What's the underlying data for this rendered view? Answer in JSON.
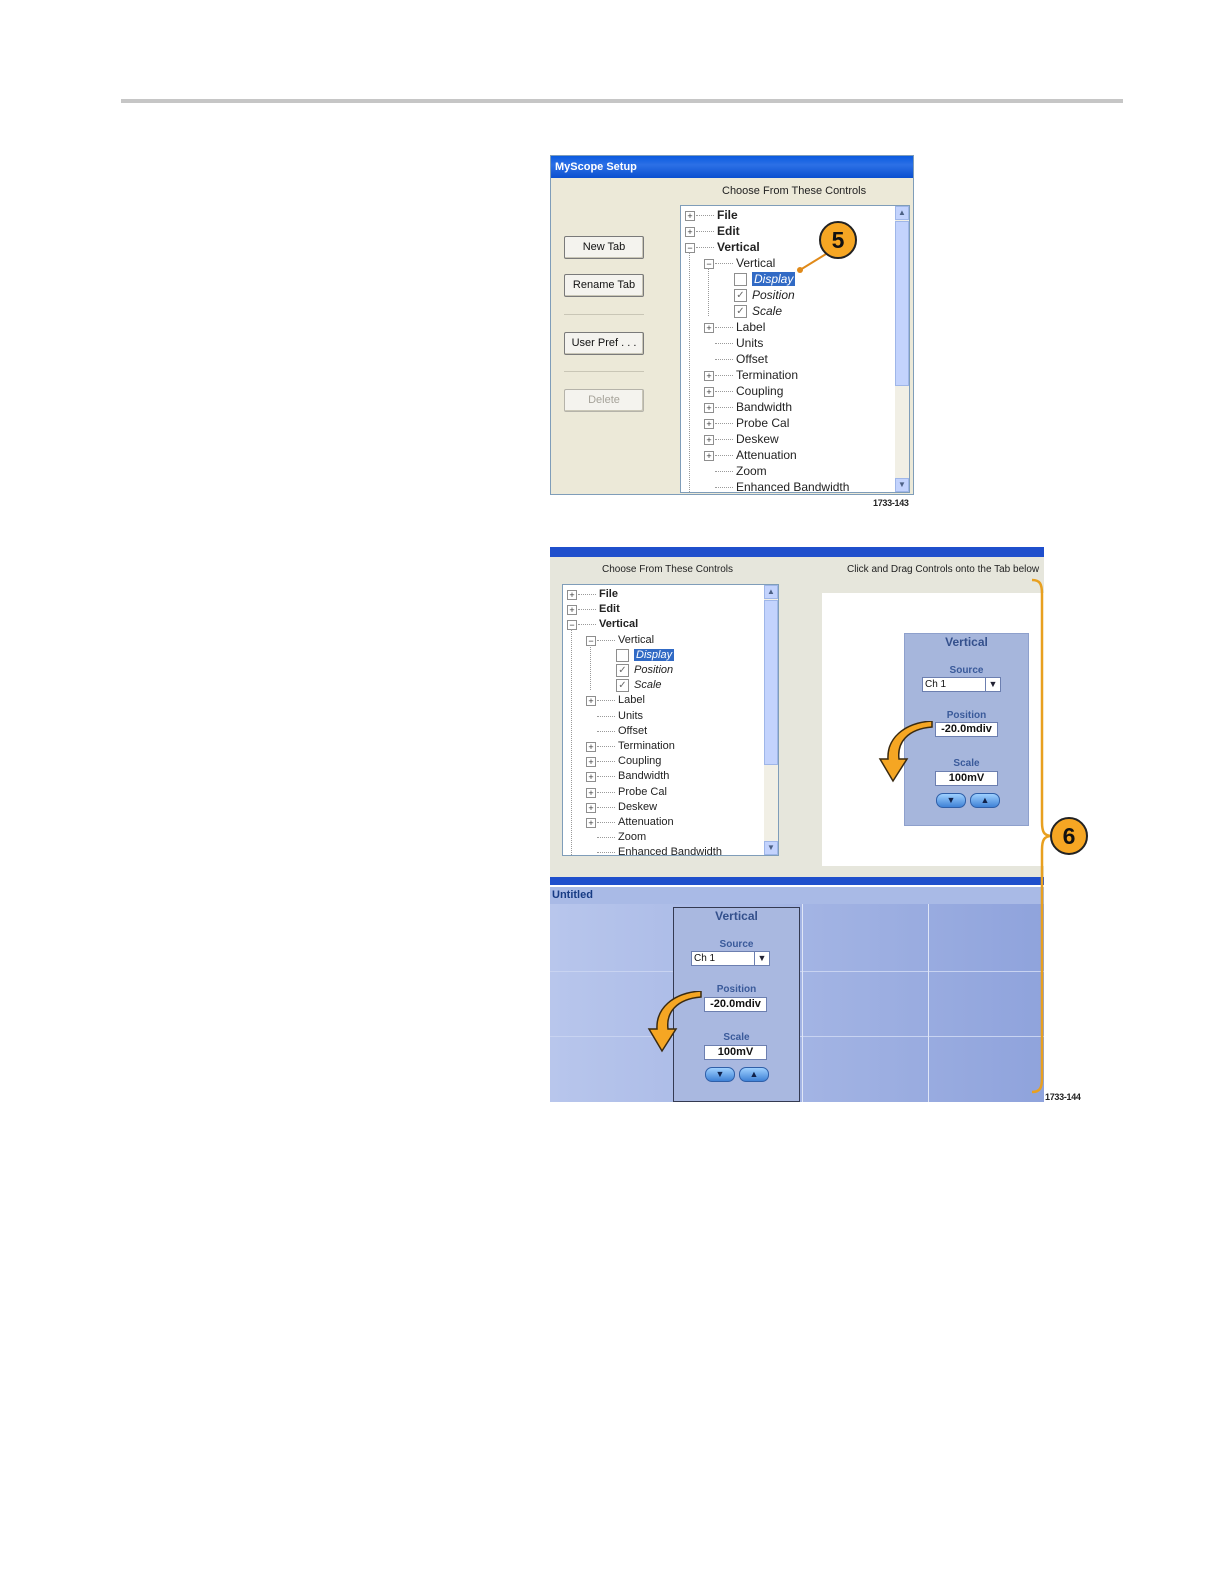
{
  "figure1": {
    "title": "MyScope Setup",
    "tree_caption": "Choose From These Controls",
    "buttons": {
      "new_tab": "New Tab",
      "rename_tab": "Rename Tab",
      "user_pref": "User Pref . . .",
      "delete": "Delete"
    },
    "tree": [
      "File",
      "Edit",
      "Vertical",
      "Vertical",
      "Display",
      "Position",
      "Scale",
      "Label",
      "Units",
      "Offset",
      "Termination",
      "Coupling",
      "Bandwidth",
      "Probe Cal",
      "Deskew",
      "Attenuation",
      "Zoom",
      "Enhanced Bandwidth"
    ],
    "callout": "5",
    "figure_number": "1733-143"
  },
  "figure2": {
    "tree_caption": "Choose From These Controls",
    "drop_caption": "Click and Drag Controls onto the Tab below",
    "tree": [
      "File",
      "Edit",
      "Vertical",
      "Vertical",
      "Display",
      "Position",
      "Scale",
      "Label",
      "Units",
      "Offset",
      "Termination",
      "Coupling",
      "Bandwidth",
      "Probe Cal",
      "Deskew",
      "Attenuation",
      "Zoom",
      "Enhanced Bandwidth"
    ],
    "control": {
      "title": "Vertical",
      "source_label": "Source",
      "source_value": "Ch 1",
      "position_label": "Position",
      "position_value": "-20.0mdiv",
      "scale_label": "Scale",
      "scale_value": "100mV"
    },
    "tab_name": "Untitled",
    "callout": "6",
    "figure_number": "1733-144"
  },
  "icons": {
    "expand": "plus-box-icon",
    "collapse": "minus-box-icon",
    "check": "checkmark-icon",
    "dropdown": "dropdown-arrow-icon",
    "down": "down-arrow-icon",
    "up": "up-arrow-icon",
    "drag": "curved-arrow-icon"
  },
  "colors": {
    "title_bar": "#0a5be0",
    "selection": "#316ac5",
    "callout": "#f6a623",
    "tab_area": "#a9bae6"
  }
}
